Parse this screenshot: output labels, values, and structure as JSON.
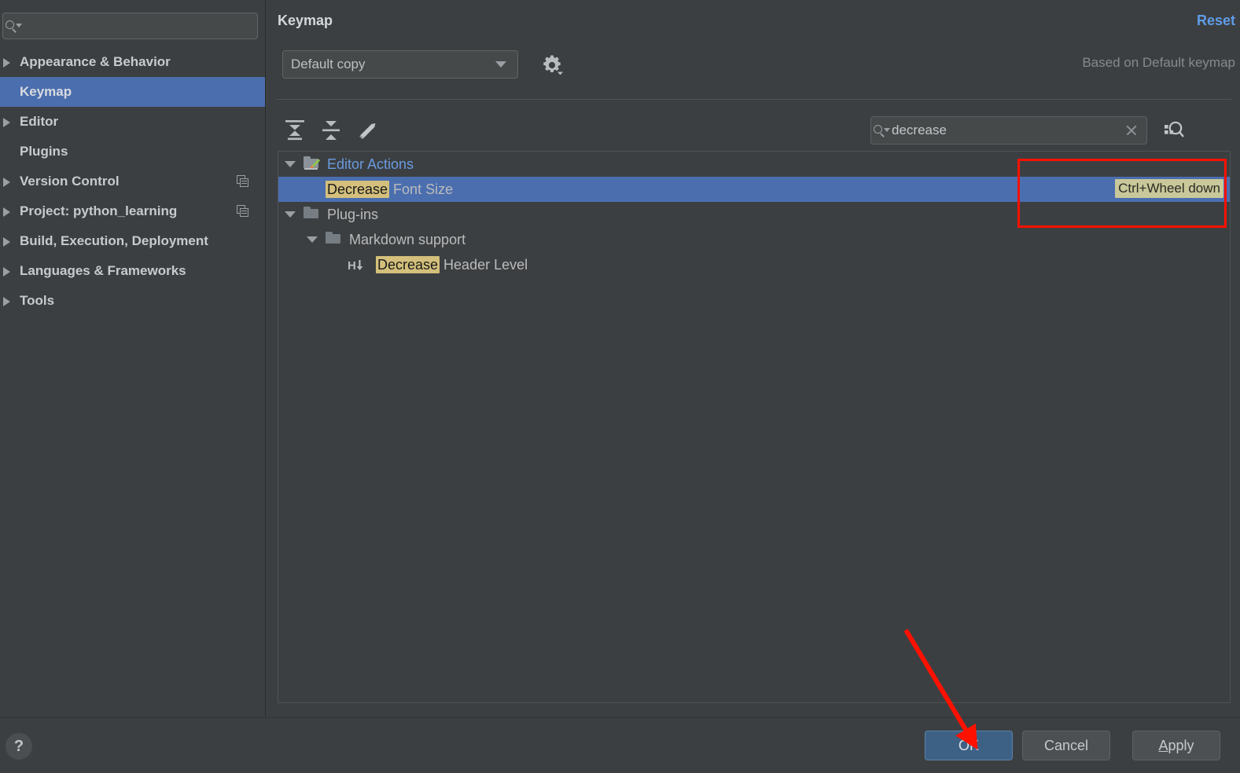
{
  "sidebar": {
    "search": {
      "value": "",
      "placeholder": "",
      "icon": "search-icon"
    },
    "items": [
      {
        "label": "Appearance & Behavior",
        "expandable": true,
        "selected": false,
        "copy_icon": false
      },
      {
        "label": "Keymap",
        "expandable": false,
        "selected": true,
        "copy_icon": false
      },
      {
        "label": "Editor",
        "expandable": true,
        "selected": false,
        "copy_icon": false
      },
      {
        "label": "Plugins",
        "expandable": false,
        "selected": false,
        "copy_icon": false
      },
      {
        "label": "Version Control",
        "expandable": true,
        "selected": false,
        "copy_icon": true
      },
      {
        "label": "Project: python_learning",
        "expandable": true,
        "selected": false,
        "copy_icon": true
      },
      {
        "label": "Build, Execution, Deployment",
        "expandable": true,
        "selected": false,
        "copy_icon": false
      },
      {
        "label": "Languages & Frameworks",
        "expandable": true,
        "selected": false,
        "copy_icon": false
      },
      {
        "label": "Tools",
        "expandable": true,
        "selected": false,
        "copy_icon": false
      }
    ]
  },
  "main": {
    "title": "Keymap",
    "reset_label": "Reset",
    "keymap_select": {
      "value": "Default copy"
    },
    "gear_label": "gear-icon",
    "based_on": "Based on Default keymap",
    "toolbar": [
      {
        "name": "expand-all-icon",
        "tooltip": "Expand All"
      },
      {
        "name": "collapse-all-icon",
        "tooltip": "Collapse All"
      },
      {
        "name": "edit-shortcut-icon",
        "tooltip": "Edit Shortcut"
      }
    ],
    "search": {
      "value": "decrease",
      "placeholder": "",
      "clear_label": "×"
    },
    "find_by_shortcut_label": "find-by-shortcut-icon"
  },
  "tree": {
    "search_term": "Decrease",
    "rows": [
      {
        "indent": 0,
        "twisty": "expanded",
        "icon": "editor-actions-folder-icon",
        "prefix": "",
        "highlight": "",
        "suffix": "Editor Actions",
        "blue": true,
        "selected": false,
        "shortcut": ""
      },
      {
        "indent": 1,
        "twisty": "none",
        "icon": "none",
        "prefix": "",
        "highlight": "Decrease",
        "suffix": " Font Size",
        "blue": false,
        "selected": true,
        "shortcut": "Ctrl+Wheel down"
      },
      {
        "indent": 0,
        "twisty": "expanded",
        "icon": "folder-icon",
        "prefix": "",
        "highlight": "",
        "suffix": "Plug-ins",
        "blue": false,
        "selected": false,
        "shortcut": ""
      },
      {
        "indent": 1,
        "twisty": "expanded",
        "icon": "folder-icon",
        "prefix": "",
        "highlight": "",
        "suffix": "Markdown support",
        "blue": false,
        "selected": false,
        "shortcut": ""
      },
      {
        "indent": 2,
        "twisty": "none",
        "icon": "header-level-down-icon",
        "prefix": "",
        "highlight": "Decrease",
        "suffix": " Header Level",
        "blue": false,
        "selected": false,
        "shortcut": ""
      }
    ]
  },
  "footer": {
    "help_label": "?",
    "ok_label": "OK",
    "cancel_label": "Cancel",
    "apply_label_mnemonic": "A",
    "apply_label_rest": "pply"
  },
  "annotations": {
    "highlight_box_color": "#fe1100",
    "arrow_color": "#fe1100"
  },
  "colors": {
    "window_bg": "#3c3f41",
    "selection_blue": "#4b6eaf",
    "accent_link": "#5f9de8",
    "search_highlight": "#d4c07c",
    "shortcut_badge": "#c9c89a",
    "tree_label_blue": "#6a9ae0"
  }
}
